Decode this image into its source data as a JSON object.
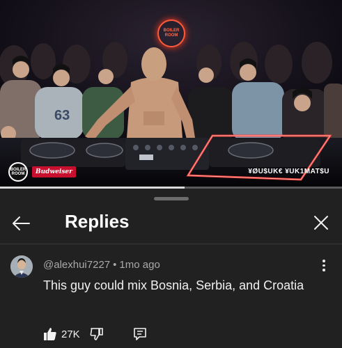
{
  "video": {
    "brand_logo": "BOILER ROOM",
    "sponsor": "Budweiser",
    "neon_sign": "BOILER ROOM",
    "artist_watermark": "¥ØU$UK€ ¥UK1MAT$U",
    "progress": 0.54
  },
  "sheet": {
    "title": "Replies",
    "back_icon": "arrow-left-icon",
    "close_icon": "close-icon"
  },
  "comment": {
    "author": "@alexhui7227",
    "separator": "•",
    "time": "1mo ago",
    "text": "This guy could mix Bosnia, Serbia, and Croatia",
    "likes": "27K",
    "icons": [
      "thumbs-up-icon",
      "thumbs-down-icon",
      "reply-icon",
      "more-vert-icon"
    ]
  }
}
